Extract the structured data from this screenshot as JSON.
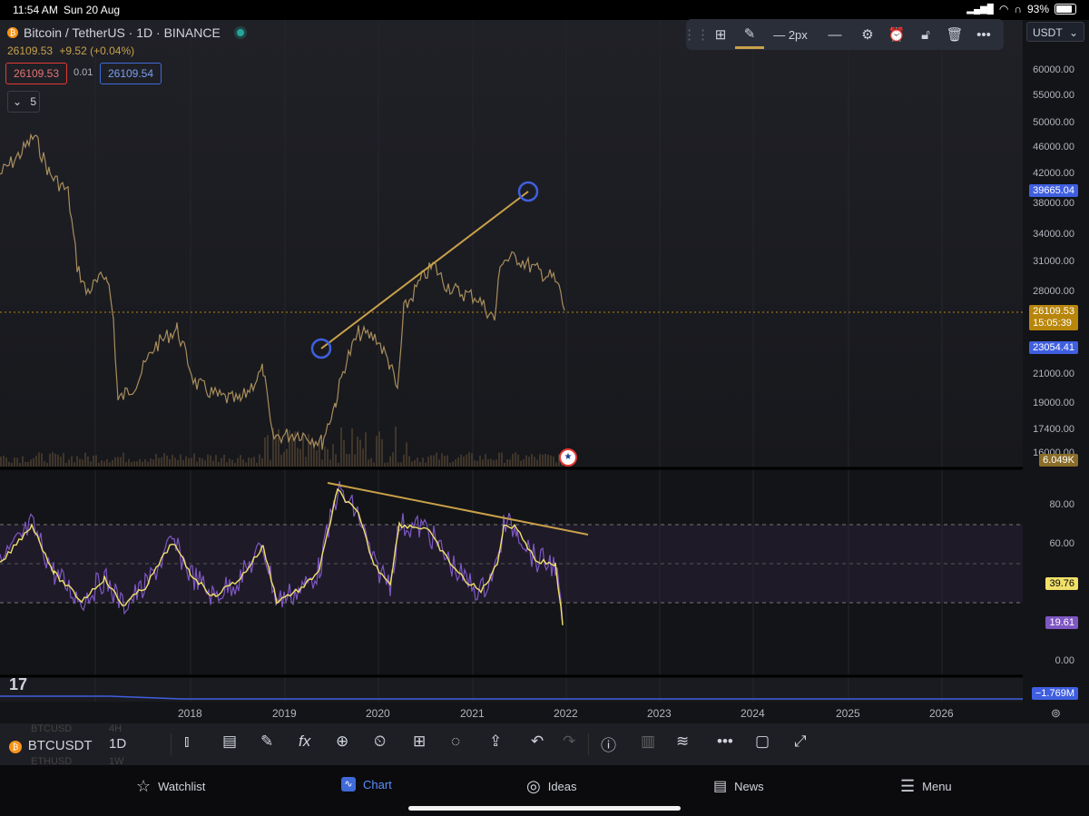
{
  "status_bar": {
    "time": "11:54 AM",
    "date": "Sun 20 Aug",
    "battery": "93%"
  },
  "symbol": {
    "title": "Bitcoin / TetherUS · 1D · BINANCE",
    "last": "26109.53",
    "change": "+9.52 (+0.04%)"
  },
  "trade": {
    "sell": "26109.53",
    "spread": "0.01",
    "buy": "26109.54"
  },
  "indicators": {
    "count": "5"
  },
  "drawing_toolbar": {
    "width_label": "2px"
  },
  "currency": "USDT",
  "price_axis": {
    "labels": [
      "60000.00",
      "55000.00",
      "50000.00",
      "46000.00",
      "42000.00",
      "38000.00",
      "34000.00",
      "31000.00",
      "28000.00",
      "21000.00",
      "19000.00",
      "17400.00",
      "16000.00"
    ],
    "tags": {
      "drawing_top": "39665.04",
      "last_price": "26109.53",
      "countdown": "15:05:39",
      "drawing_bottom": "23054.41",
      "volume": "6.049K"
    }
  },
  "rsi_axis": {
    "labels": [
      "80.00",
      "60.00",
      "0.00"
    ],
    "ma_value": "39.76",
    "rsi_value": "19.61"
  },
  "macd_axis": {
    "value": "−1.769M"
  },
  "time_axis": {
    "labels": [
      "2018",
      "2019",
      "2020",
      "2021",
      "2022",
      "2023",
      "2024",
      "2025",
      "2026"
    ]
  },
  "bottom_toolbar": {
    "symbol": "BTCUSDT",
    "interval": "1D",
    "ghost_symbol": "BTCUSD",
    "ghost_interval": "4H",
    "ghost_symbol2": "ETHUSD",
    "ghost_interval2": "1W"
  },
  "tabs": [
    {
      "label": "Watchlist",
      "icon": "star-icon"
    },
    {
      "label": "Chart",
      "icon": "chart-icon"
    },
    {
      "label": "Ideas",
      "icon": "lightbulb-icon"
    },
    {
      "label": "News",
      "icon": "news-icon"
    },
    {
      "label": "Menu",
      "icon": "menu-icon"
    }
  ],
  "colors": {
    "accent": "#5b8cff",
    "trendline": "#c9a14a",
    "rsi": "#7e57c2",
    "rsi_ma": "#f0e06a",
    "last_price": "#b8860b"
  }
}
